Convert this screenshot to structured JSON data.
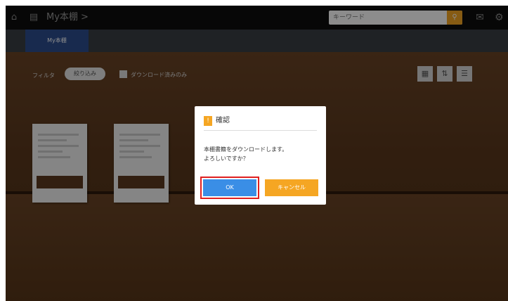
{
  "topbar": {
    "title": "My本棚 >",
    "search_placeholder": "キーワード",
    "search_icon": "search-icon",
    "accent": "#f5a623"
  },
  "tabs": [
    {
      "label": "My本棚",
      "active": true
    },
    {
      "label": "",
      "active": false
    },
    {
      "label": "",
      "active": false
    }
  ],
  "toolbar": {
    "filter_label": "フィルタ",
    "filter_value": "絞り込み",
    "checkbox_label": "ダウンロード済みのみ"
  },
  "books": [
    {
      "title": ""
    },
    {
      "title": ""
    }
  ],
  "dialog": {
    "title": "確認",
    "message_line1": "本棚書籍をダウンロードします。",
    "message_line2": "よろしいですか？",
    "ok_label": "OK",
    "cancel_label": "キャンセル"
  }
}
